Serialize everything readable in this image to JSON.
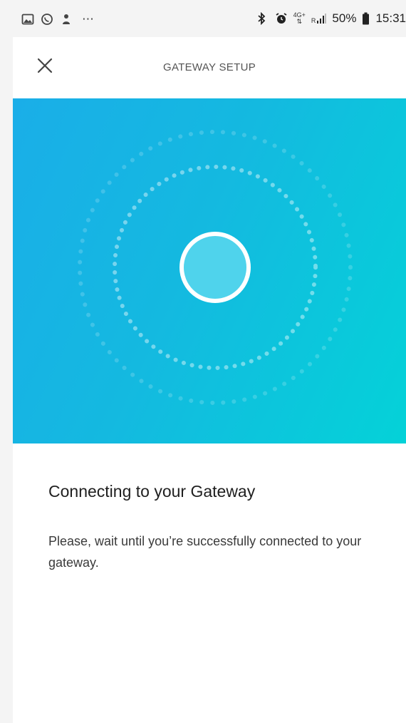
{
  "status_bar": {
    "left_icons": [
      "gallery-icon",
      "whatsapp-icon",
      "person-icon"
    ],
    "overflow": "⋯",
    "network_label": "4G+",
    "signal_label": "R",
    "battery": "50%",
    "time": "15:31"
  },
  "header": {
    "title": "GATEWAY SETUP",
    "close_icon": "close-icon"
  },
  "hero": {
    "graphic": "connecting-radar",
    "colors": {
      "gradient_start": "#1aaee8",
      "gradient_end": "#04d2d8",
      "ring": "#ffffff"
    }
  },
  "content": {
    "title": "Connecting to your Gateway",
    "description": "Please, wait until you’re successfully connected to your gateway."
  }
}
